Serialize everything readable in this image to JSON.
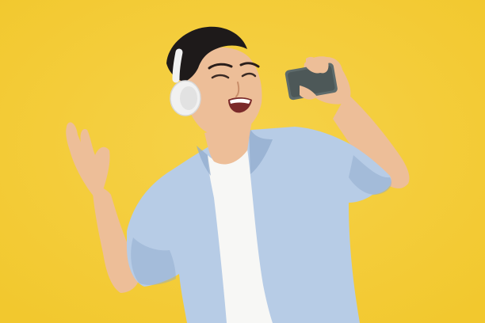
{
  "scene": {
    "subject": "man",
    "accessory": "headphones",
    "device": "smartphone"
  },
  "colors": {
    "background": "#F2C82E",
    "background_light": "#F6D24A",
    "shirt": "#B7CCE6",
    "shirt_shadow": "#8FA9CC",
    "tshirt": "#F7F7F5",
    "skin": "#EDBE98",
    "skin_shadow": "#D59D77",
    "hair": "#1E1A1A",
    "headphones": "#F1F1F1",
    "phone": "#5E6B6B"
  }
}
